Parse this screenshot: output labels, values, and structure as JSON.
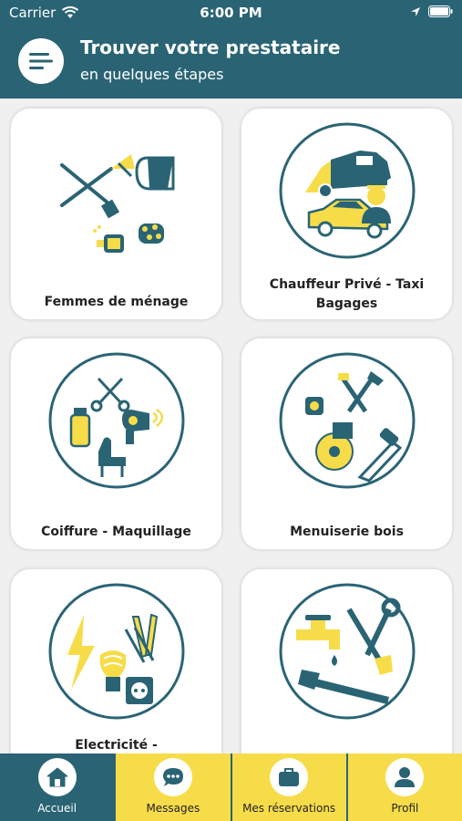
{
  "status_bar": {
    "carrier": "Carrier",
    "time": "6:00 PM"
  },
  "header": {
    "title": "Trouver votre prestataire",
    "subtitle": "en quelques étapes"
  },
  "categories": [
    {
      "label": "Femmes de ménage",
      "icon": "cleaning-tools-icon"
    },
    {
      "label": "Chauffeur Privé - Taxi Bagages",
      "icon": "driver-taxi-icon"
    },
    {
      "label": "Coiffure - Maquillage",
      "icon": "hairdressing-icon"
    },
    {
      "label": "Menuiserie bois",
      "icon": "carpentry-tools-icon"
    },
    {
      "label": "Electricité -",
      "icon": "electricity-icon"
    },
    {
      "label": "",
      "icon": "plumbing-icon"
    }
  ],
  "tabbar": {
    "items": [
      {
        "label": "Accueil",
        "icon": "home-icon",
        "active": true
      },
      {
        "label": "Messages",
        "icon": "chat-icon",
        "active": false
      },
      {
        "label": "Mes réservations",
        "icon": "briefcase-icon",
        "active": false
      },
      {
        "label": "Profil",
        "icon": "user-icon",
        "active": false
      }
    ]
  },
  "colors": {
    "primary": "#2a6474",
    "accent": "#f7dc4a",
    "background": "#f0f0f0"
  }
}
